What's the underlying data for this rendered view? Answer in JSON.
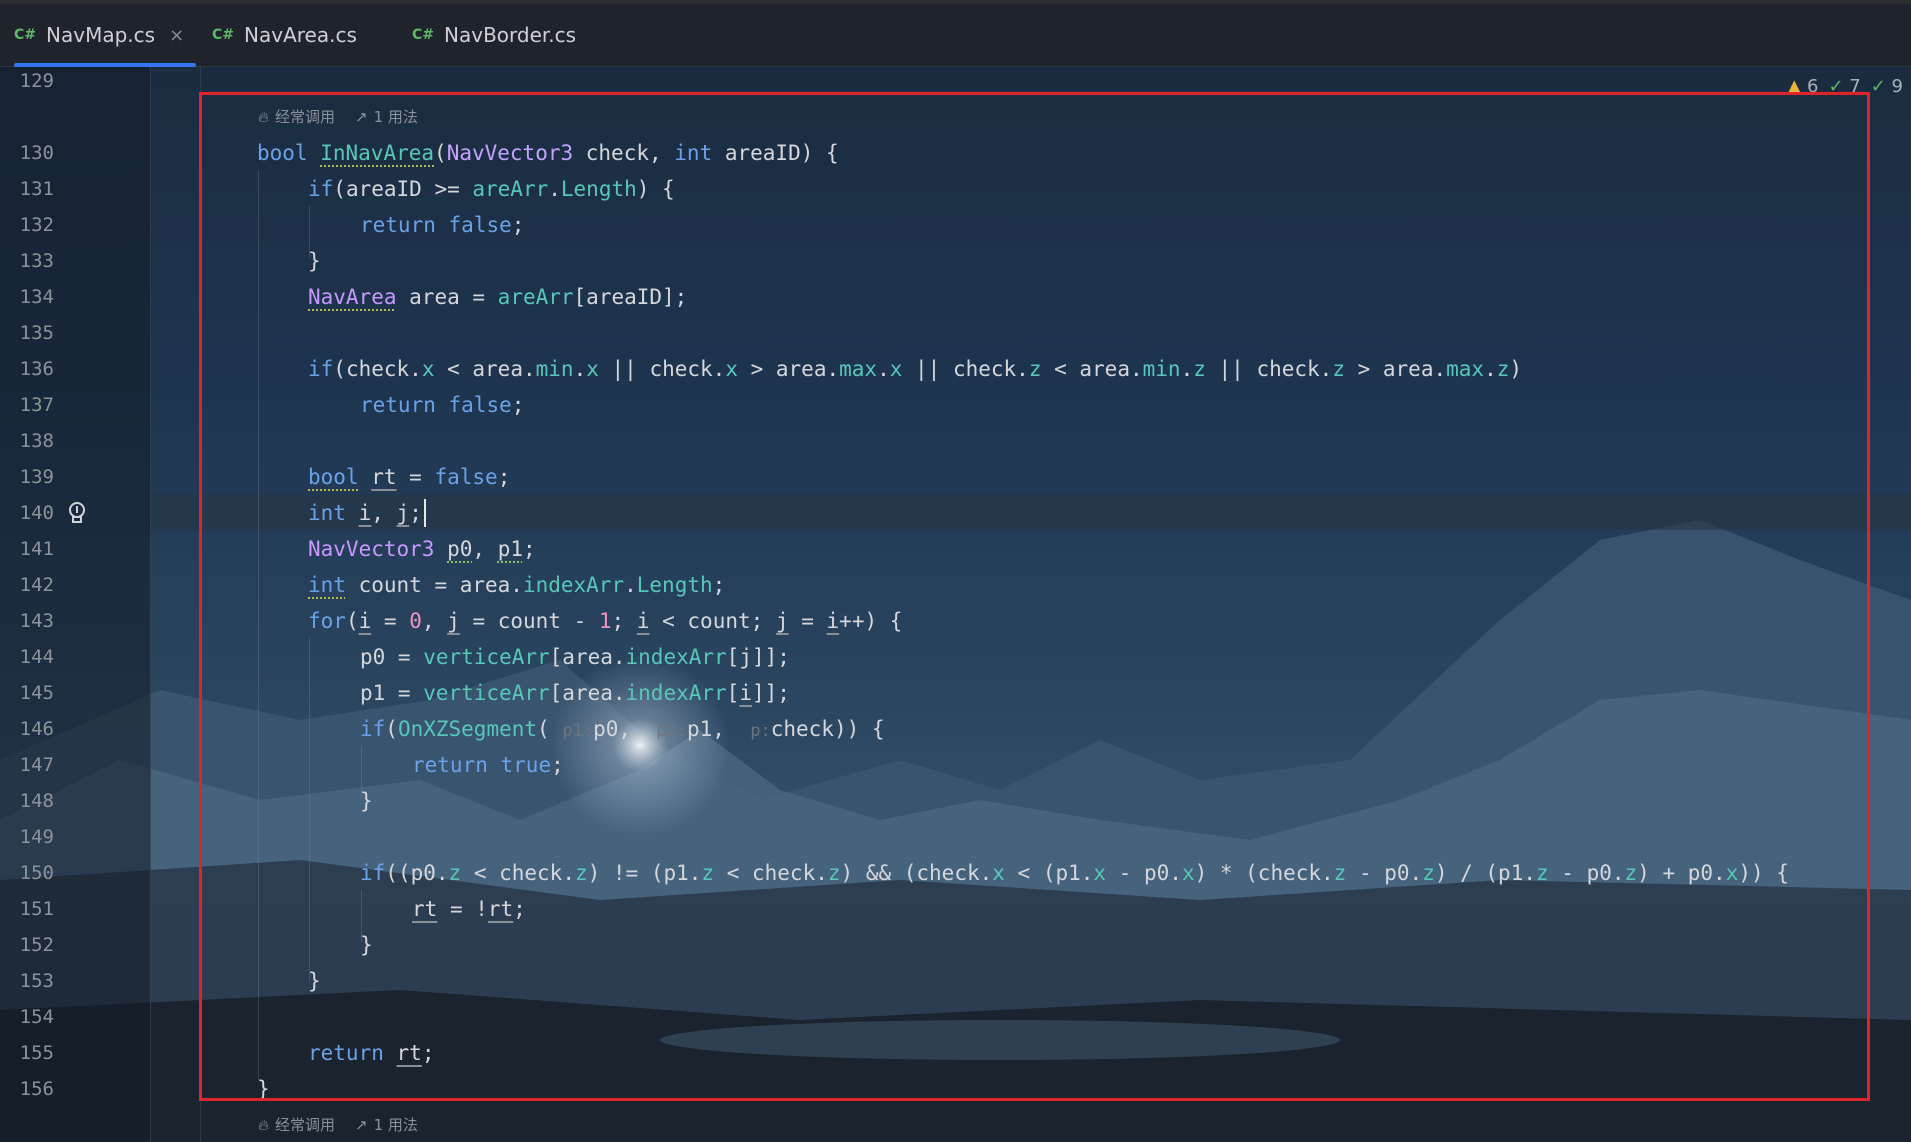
{
  "tabs": [
    {
      "lang": "C#",
      "name": "NavMap.cs",
      "active": true,
      "close": "×"
    },
    {
      "lang": "C#",
      "name": "NavArea.cs",
      "active": false
    },
    {
      "lang": "C#",
      "name": "NavBorder.cs",
      "active": false
    }
  ],
  "status": {
    "warnings": "6",
    "checks": "7",
    "checks2": "9"
  },
  "lens": {
    "frequent": "经常调用",
    "usages": "1 用法"
  },
  "line_numbers": [
    "129",
    "130",
    "131",
    "132",
    "133",
    "134",
    "135",
    "136",
    "137",
    "138",
    "139",
    "140",
    "141",
    "142",
    "143",
    "144",
    "145",
    "146",
    "147",
    "148",
    "149",
    "150",
    "151",
    "152",
    "153",
    "154",
    "155",
    "156"
  ],
  "code": {
    "l130": {
      "kw": "bool",
      "fn": "InNavArea",
      "p1": "(",
      "ty": "NavVector3",
      "p2": " check, ",
      "kw2": "int",
      "p3": " areaID) {"
    },
    "l131": {
      "kw": "if",
      "p1": "(areaID >= ",
      "f1": "areArr",
      "p2": ".",
      "f2": "Length",
      "p3": ") {"
    },
    "l132": {
      "kw": "return",
      "p1": " ",
      "kw2": "false",
      "p2": ";"
    },
    "l133": {
      "p1": "}"
    },
    "l134": {
      "ty": "NavArea",
      "p1": " area = ",
      "f1": "areArr",
      "p2": "[areaID];"
    },
    "l136": {
      "kw": "if",
      "p1": "(check.",
      "a1": "x",
      "p2": " < area.",
      "a2": "min",
      "p3": ".",
      "a3": "x",
      "p4": " || check.",
      "a4": "x",
      "p5": " > area.",
      "a5": "max",
      "p6": ".",
      "a6": "x",
      "p7": " || check.",
      "a7": "z",
      "p8": " < area.",
      "a8": "min",
      "p9": ".",
      "a9": "z",
      "p10": " || check.",
      "a10": "z",
      "p11": " > area.",
      "a11": "max",
      "p12": ".",
      "a12": "z",
      "p13": ")"
    },
    "l137": {
      "kw": "return",
      "p1": " ",
      "kw2": "false",
      "p2": ";"
    },
    "l139": {
      "kw": "bool",
      "p1": " ",
      "v": "rt",
      "p2": " = ",
      "kw2": "false",
      "p3": ";"
    },
    "l140": {
      "kw": "int",
      "p1": " ",
      "v1": "i",
      "p2": ", ",
      "v2": "j",
      "p3": ";"
    },
    "l141": {
      "ty": "NavVector3",
      "p1": " ",
      "v1": "p0",
      "p2": ", ",
      "v2": "p1",
      "p3": ";"
    },
    "l142": {
      "kw": "int",
      "p1": " count = area.",
      "f1": "indexArr",
      "p2": ".",
      "f2": "Length",
      "p3": ";"
    },
    "l143": {
      "kw": "for",
      "p1": "(",
      "v1": "i",
      "p2": " = ",
      "n1": "0",
      "p3": ", ",
      "v2": "j",
      "p4": " = count - ",
      "n2": "1",
      "p5": "; ",
      "v3": "i",
      "p6": " < count; ",
      "v4": "j",
      "p7": " = ",
      "v5": "i",
      "p8": "++) {"
    },
    "l144": {
      "p1": "p0 = ",
      "f1": "verticeArr",
      "p2": "[area.",
      "f2": "indexArr",
      "p3": "[j]];"
    },
    "l145": {
      "p1": "p1 = ",
      "f1": "verticeArr",
      "p2": "[area.",
      "f2": "indexArr",
      "p3": "[",
      "v": "i",
      "p4": "]];"
    },
    "l146": {
      "kw": "if",
      "p1": "(",
      "fn": "OnXZSegment",
      "p2": "(",
      "h1": "p1:",
      "a1": "p0, ",
      "h2": "p2:",
      "a2": "p1, ",
      "h3": "p:",
      "a3": "check)) {"
    },
    "l147": {
      "kw": "return",
      "p1": " ",
      "kw2": "true",
      "p2": ";"
    },
    "l148": {
      "p1": "}"
    },
    "l150": {
      "kw": "if",
      "p1": "((p0.",
      "a1": "z",
      "p2": " < check.",
      "a2": "z",
      "p3": ") != (p1.",
      "a3": "z",
      "p4": " < check.",
      "a4": "z",
      "p5": ") && (check.",
      "a5": "x",
      "p6": " < (p1.",
      "a6": "x",
      "p7": " - p0.",
      "a7": "x",
      "p8": ") * (check.",
      "a8": "z",
      "p9": " - p0.",
      "a9": "z",
      "p10": ") / (p1.",
      "a10": "z",
      "p11": " - p0.",
      "a11": "z",
      "p12": ") + p0.",
      "a12": "x",
      "p13": ")) {"
    },
    "l151": {
      "v1": "rt",
      "p1": " = !",
      "v2": "rt",
      "p2": ";"
    },
    "l152": {
      "p1": "}"
    },
    "l153": {
      "p1": "}"
    },
    "l155": {
      "kw": "return",
      "p1": " ",
      "v": "rt",
      "p2": ";"
    },
    "l156": {
      "p1": "}"
    }
  }
}
